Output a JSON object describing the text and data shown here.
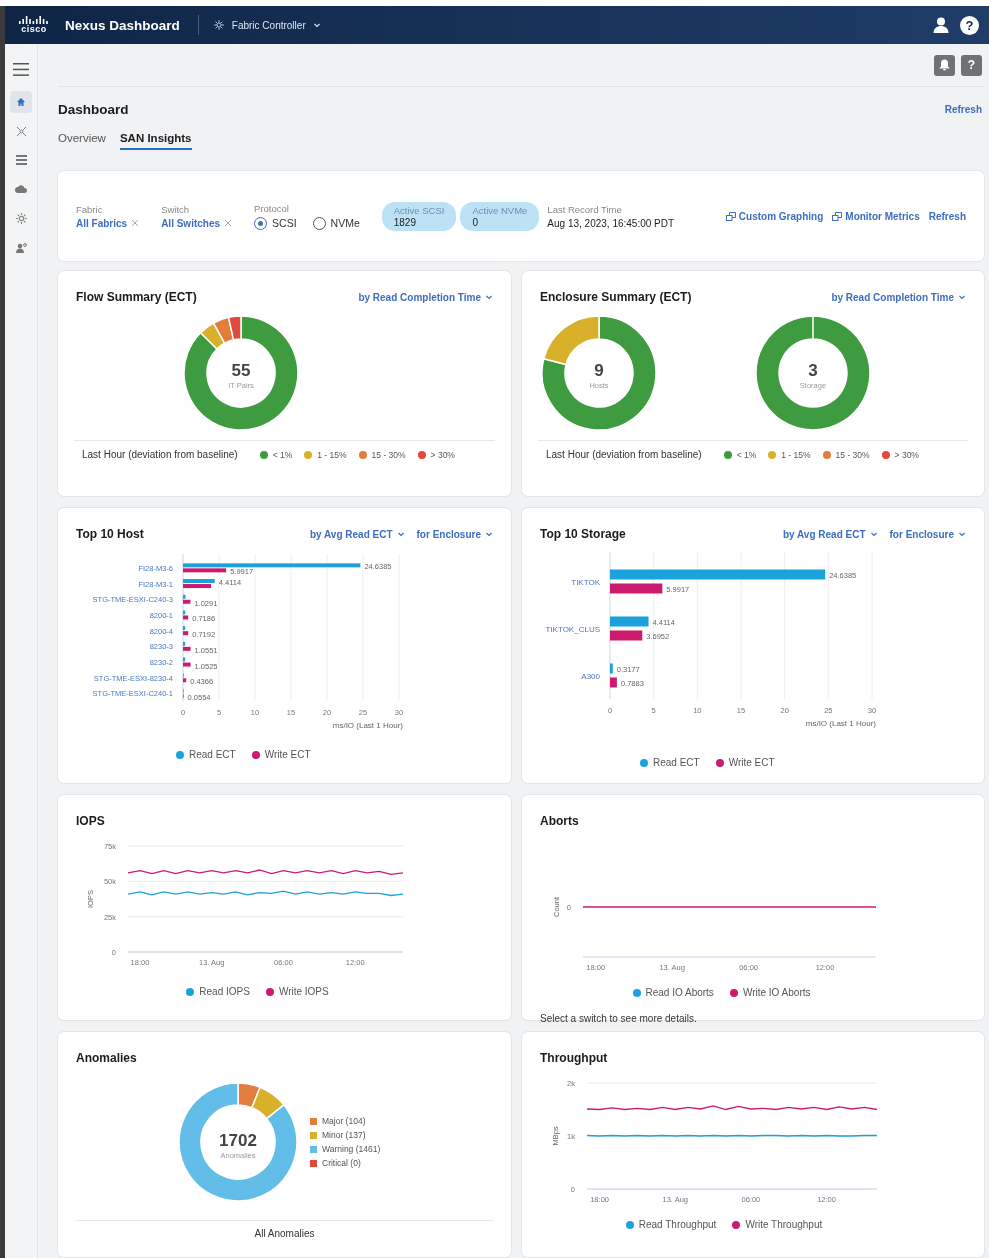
{
  "header": {
    "logo_text": "cisco",
    "product": "Nexus Dashboard",
    "app_switcher": "Fabric Controller",
    "help_label": "?"
  },
  "sidebar": {
    "items": [
      {
        "selected": true
      },
      {
        "selected": false
      },
      {
        "selected": false
      },
      {
        "selected": false
      },
      {
        "selected": false
      },
      {
        "selected": false
      }
    ]
  },
  "toolbar": {
    "help_label": "?"
  },
  "page": {
    "title": "Dashboard",
    "refresh": "Refresh"
  },
  "tabs": [
    {
      "label": "Overview",
      "selected": false
    },
    {
      "label": "SAN Insights",
      "selected": true
    }
  ],
  "filters": {
    "fabric": {
      "label": "Fabric",
      "value": "All Fabrics"
    },
    "switch": {
      "label": "Switch",
      "value": "All Switches"
    },
    "protocol": {
      "label": "Protocol",
      "options": [
        {
          "label": "SCSI",
          "selected": true
        },
        {
          "label": "NVMe",
          "selected": false
        }
      ]
    },
    "counters": [
      {
        "label": "Active SCSI",
        "value": "1829"
      },
      {
        "label": "Active NVMe",
        "value": "0"
      }
    ],
    "last_record": {
      "label": "Last Record Time",
      "value": "Aug 13, 2023, 16:45:00 PDT"
    },
    "links": [
      "Custom Graphing",
      "Monitor Metrics"
    ],
    "refresh": "Refresh"
  },
  "flow_summary": {
    "title": "Flow Summary (ECT)",
    "selector": "by Read Completion Time",
    "donuts": [
      {
        "count": "55",
        "caption": "IT Pairs"
      }
    ],
    "footer": "Last Hour (deviation from baseline)",
    "legend": [
      {
        "label": "< 1%",
        "color": "#3e9b3f"
      },
      {
        "label": "1 - 15%",
        "color": "#d8b02a"
      },
      {
        "label": "15 - 30%",
        "color": "#e57c3c"
      },
      {
        "label": "> 30%",
        "color": "#e0493d"
      }
    ]
  },
  "enclosure_summary": {
    "title": "Enclosure Summary (ECT)",
    "selector": "by Read Completion Time",
    "donuts": [
      {
        "count": "9",
        "caption": "Hosts"
      },
      {
        "count": "3",
        "caption": "Storage"
      }
    ],
    "footer": "Last Hour (deviation from baseline)",
    "legend": [
      {
        "label": "< 1%",
        "color": "#3e9b3f"
      },
      {
        "label": "1 - 15%",
        "color": "#d8b02a"
      },
      {
        "label": "15 - 30%",
        "color": "#e57c3c"
      },
      {
        "label": "> 30%",
        "color": "#e0493d"
      }
    ]
  },
  "top_hosts": {
    "title": "Top 10 Host",
    "selectors": [
      "by Avg Read ECT",
      "for Enclosure"
    ],
    "chart_data": {
      "type": "bar",
      "orientation": "horizontal",
      "grid": true,
      "xlabel": "ms/IO (Last 1 Hour)",
      "categories": [
        "FI28-M3-6",
        "FI28-M3-1",
        "STG-TME-ESXI-C240-3",
        "8200-1",
        "8200-4",
        "8230-3",
        "8230-2",
        "STG-TME-ESXI-8230-4",
        "STG-TME-ESXI-C240-1"
      ],
      "series": [
        {
          "name": "Read ECT",
          "color": "#1ba1dc",
          "values": [
            24.6385,
            4.4114,
            0.35,
            0.3,
            0.3,
            0.3,
            0.3,
            0.1,
            0.02
          ]
        },
        {
          "name": "Write ECT",
          "color": "#cc1a6f",
          "values": [
            5.9917,
            3.9,
            1.0291,
            0.7186,
            0.7192,
            1.0551,
            1.0525,
            0.4366,
            0.0554
          ]
        }
      ],
      "xlim": [
        0,
        30
      ],
      "xticks": [
        0,
        5,
        10,
        15,
        20,
        25,
        30
      ],
      "value_labels": [
        [
          "24.6385",
          "4.4114",
          null,
          null,
          null,
          null,
          null,
          null,
          null
        ],
        [
          "5.9917",
          null,
          "1.0291",
          "0.7186",
          "0.7192",
          "1.0551",
          "1.0525",
          "0.4366",
          "0.0554"
        ]
      ]
    }
  },
  "top_storage": {
    "title": "Top 10 Storage",
    "selectors": [
      "by Avg Read ECT",
      "for Enclosure"
    ],
    "chart_data": {
      "type": "bar",
      "orientation": "horizontal",
      "grid": true,
      "xlabel": "ms/IO (Last 1 Hour)",
      "categories": [
        "TIKTOK",
        "TIKTOK_CLUS",
        "A300"
      ],
      "series": [
        {
          "name": "Read ECT",
          "color": "#1ba1dc",
          "values": [
            24.6385,
            4.4114,
            0.3177
          ]
        },
        {
          "name": "Write ECT",
          "color": "#cc1a6f",
          "values": [
            5.9917,
            3.6952,
            0.7883
          ]
        }
      ],
      "xlim": [
        0,
        30
      ],
      "xticks": [
        0,
        5,
        10,
        15,
        20,
        25,
        30
      ],
      "value_labels": [
        [
          "24.6385",
          "4.4114",
          "0.3177"
        ],
        [
          "5.9917",
          "3.6952",
          "0.7883"
        ]
      ]
    }
  },
  "iops": {
    "title": "IOPS",
    "chart_data": {
      "type": "line",
      "ylabel": "IOPS",
      "categories": [
        null,
        "18:00",
        null,
        null,
        null,
        null,
        null,
        "13. Aug",
        null,
        null,
        null,
        null,
        null,
        "06:00",
        null,
        null,
        null,
        null,
        null,
        "12:00",
        null,
        null,
        null,
        null
      ],
      "ylim": [
        0,
        75000
      ],
      "yticks": [
        {
          "value": 0,
          "label": "0"
        },
        {
          "value": 25000,
          "label": "25k"
        },
        {
          "value": 50000,
          "label": "50k"
        },
        {
          "value": 75000,
          "label": "75k"
        }
      ],
      "series": [
        {
          "name": "Read IOPS",
          "color": "#1ba1dc",
          "values": [
            41000,
            42500,
            40500,
            42500,
            41000,
            42500,
            41000,
            42000,
            41000,
            42500,
            40500,
            42000,
            41500,
            43000,
            41000,
            42500,
            41000,
            42000,
            41000,
            42500,
            41500,
            41500,
            40000,
            41000
          ]
        },
        {
          "name": "Write IOPS",
          "color": "#cc1a6f",
          "values": [
            56000,
            57500,
            55500,
            57500,
            55500,
            57500,
            56000,
            57500,
            56000,
            57500,
            56000,
            58000,
            55500,
            57500,
            56000,
            57500,
            56000,
            57500,
            55500,
            57500,
            56000,
            57000,
            55000,
            56000
          ]
        }
      ]
    }
  },
  "aborts": {
    "title": "Aborts",
    "axis_title": "Count",
    "y_label": "0",
    "x_labels": [
      "18:00",
      "13. Aug",
      "06:00",
      "12:00"
    ],
    "legend": [
      {
        "label": "Read IO Aborts",
        "color": "#1ba1dc"
      },
      {
        "label": "Write IO Aborts",
        "color": "#cc1a6f"
      }
    ],
    "note": "Select a switch to see more details."
  },
  "anomalies": {
    "title": "Anomalies",
    "total": "1702",
    "caption": "Anomalies",
    "legend": [
      {
        "color": "#e27d3d"
      },
      {
        "color": "#d8b02a"
      },
      {
        "color": "#62bde8"
      },
      {
        "color": "#e0493d"
      }
    ],
    "chart_data": {
      "type": "donut",
      "categories": [
        "Major (104)",
        "Minor (137)",
        "Warning (1461)",
        "Critical (0)"
      ],
      "values": [
        104,
        137,
        1461,
        0
      ]
    },
    "footer": "All Anomalies"
  },
  "throughput": {
    "title": "Throughput",
    "chart_data": {
      "type": "line",
      "ylabel": "MBps",
      "categories": [
        null,
        "18:00",
        null,
        null,
        null,
        null,
        null,
        "13. Aug",
        null,
        null,
        null,
        null,
        null,
        "06:00",
        null,
        null,
        null,
        null,
        null,
        "12:00",
        null,
        null,
        null,
        null
      ],
      "ylim": [
        0,
        2000
      ],
      "yticks": [
        {
          "value": 0,
          "label": "0"
        },
        {
          "value": 1000,
          "label": "1k"
        },
        {
          "value": 2000,
          "label": "2k"
        }
      ],
      "series": [
        {
          "name": "Read Throughput",
          "color": "#1ba1dc",
          "values": [
            1010,
            1000,
            1010,
            1000,
            1010,
            1000,
            1010,
            1000,
            1010,
            1000,
            1010,
            1000,
            1010,
            1000,
            1010,
            1010,
            1000,
            1010,
            1000,
            1010,
            1000,
            1000,
            1010,
            1010
          ]
        },
        {
          "name": "Write Throughput",
          "color": "#cc1a6f",
          "values": [
            1510,
            1500,
            1530,
            1500,
            1520,
            1500,
            1540,
            1500,
            1540,
            1510,
            1570,
            1500,
            1560,
            1510,
            1520,
            1500,
            1540,
            1510,
            1540,
            1500,
            1550,
            1510,
            1540,
            1500
          ]
        }
      ]
    }
  }
}
